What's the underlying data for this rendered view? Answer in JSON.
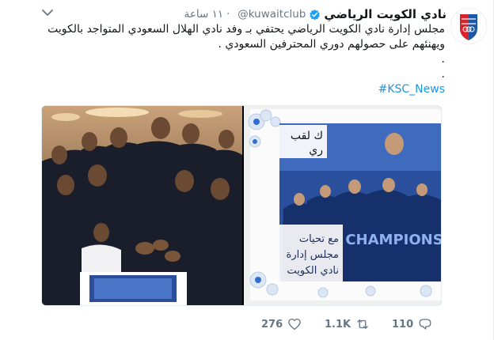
{
  "tweet": {
    "display_name": "نادي الكويت الرياضي",
    "handle": "@kuwaitclub",
    "time": "١١ ساعة",
    "lines": [
      "مجلس إدارة نادي الكويت الرياضي يحتفي بـ وفد نادي الهلال السعودي المتواجد بالكويت",
      "ويهنئهم على حصولهم دوري المحترفين السعودي .",
      ".",
      "."
    ],
    "hashtag": "#KSC_News"
  },
  "media": {
    "cake_text_top": "ك لقب",
    "cake_text_top2": "ري",
    "cake_text_msg1": "مع تحيات",
    "cake_text_msg2": "مجلس إدارة",
    "cake_text_msg3": "نادي الكويت",
    "cake_banner": "CHAMPIONS"
  },
  "actions": {
    "likes": "276",
    "retweets": "1.1K",
    "replies": "110"
  },
  "colors": {
    "verified": "#1da1f2",
    "hashtag": "#1b95e0",
    "muted": "#657786",
    "brand_blue": "#1d58a6"
  }
}
